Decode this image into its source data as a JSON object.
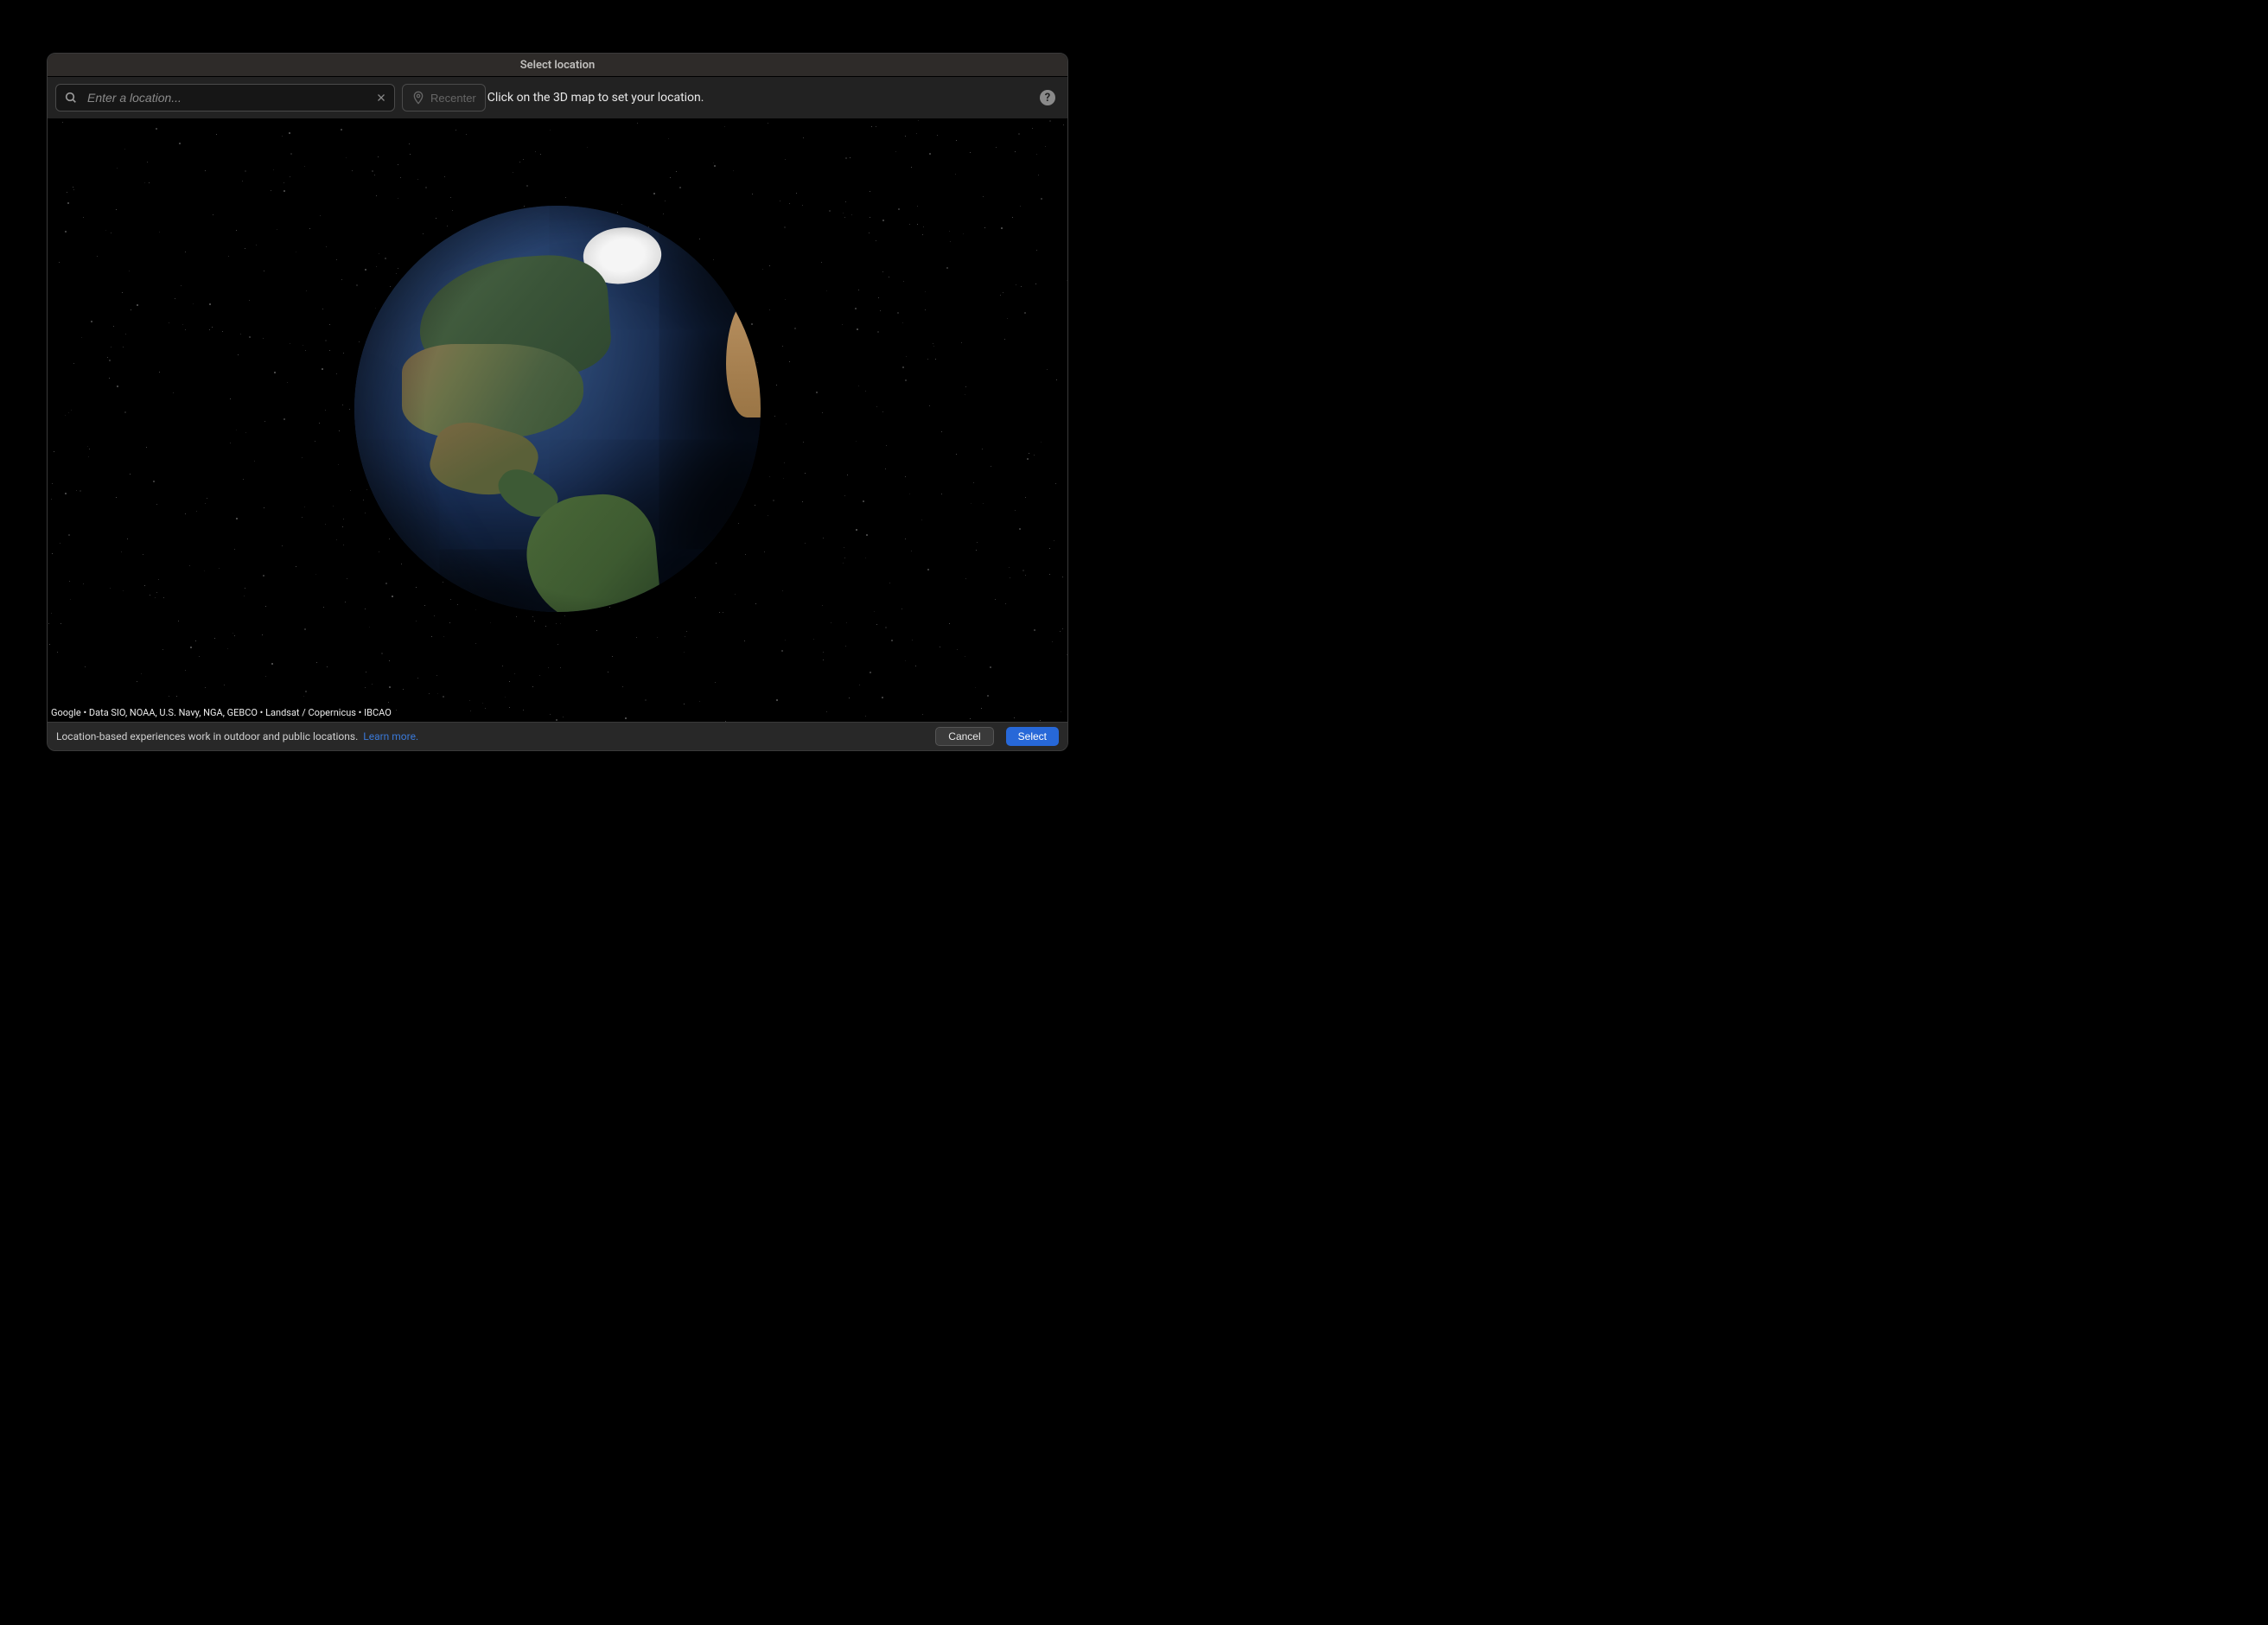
{
  "window": {
    "title": "Select location"
  },
  "toolbar": {
    "search_placeholder": "Enter a location...",
    "search_value": "",
    "recenter_label": "Recenter",
    "hint_text": "Click on the 3D map to set your location.",
    "help_label": "?"
  },
  "map": {
    "attribution": "Google • Data SIO, NOAA, U.S. Navy, NGA, GEBCO • Landsat / Copernicus • IBCAO"
  },
  "footer": {
    "info_text": "Location-based experiences work in outdoor and public locations.",
    "learn_more_label": "Learn more.",
    "cancel_label": "Cancel",
    "select_label": "Select"
  }
}
